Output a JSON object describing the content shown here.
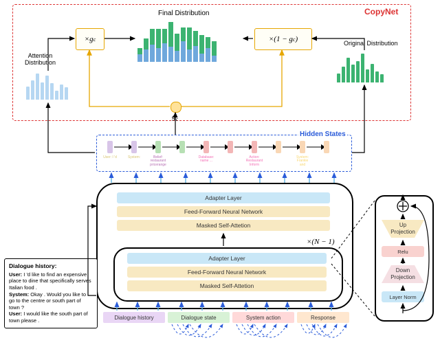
{
  "copynet": {
    "title": "CopyNet",
    "mult_left": "×g",
    "mult_left_sub": "c",
    "mult_right": "×(1 − g",
    "mult_right_sub": "c",
    "mult_right_tail": ")",
    "gc_label": "g",
    "gc_sub": "c",
    "final_label": "Final Distribution",
    "attention_label": "Attention\nDistribution",
    "original_label": "Original Distribution"
  },
  "hidden": {
    "title": "Hidden States",
    "tokens": [
      {
        "label": "User: I 'd",
        "color": "#d8c5e8"
      },
      {
        "label": "System:",
        "color": "#d8c5e8"
      },
      {
        "label": "Belief: restaurant pricerange",
        "color": "#b7e0b4"
      },
      {
        "label": "",
        "color": "#b7e0b4"
      },
      {
        "label": "Database: name ...",
        "color": "#f3b6b6"
      },
      {
        "label": "",
        "color": "#f3b6b6"
      },
      {
        "label": "Action: Restaurant Inform",
        "color": "#f3b6b6"
      },
      {
        "label": "",
        "color": "#f9d7b5"
      },
      {
        "label": "System: Frankie and",
        "color": "#f9d7b5"
      },
      {
        "label": "",
        "color": "#f9d7b5"
      }
    ]
  },
  "transformer": {
    "outer": {
      "adapter": "Adapter Layer",
      "ffn": "Feed-Forward Neural Network",
      "attn": "Masked Self-Attetion"
    },
    "inner": {
      "adapter": "Adapter Layer",
      "ffn": "Feed-Forward Neural Network",
      "attn": "Masked Self-Attetion"
    },
    "repeat": "×(N − 1)"
  },
  "segments": {
    "history": "Dialogue history",
    "state": "Dialogue state",
    "action": "System action",
    "response": "Response"
  },
  "dialogue": {
    "title": "Dialogue history:",
    "u1_role": "User:",
    "u1": "I 'd like to find an expensive place to dine that specifically serves Italian food .",
    "s1_role": "System:",
    "s1": "Okay . Would you like to go to the centre or south part of town ?",
    "u2_role": "User:",
    "u2": "I would like the south part of town please ."
  },
  "adapter_detail": {
    "layernorm": "Layer Norm",
    "down": "Down\nProjection",
    "relu": "Relu",
    "up": "Up\nProjection"
  },
  "chart_data": {
    "attention": {
      "type": "bar",
      "color": "#b6d7f2",
      "values": [
        30,
        45,
        60,
        40,
        55,
        38,
        20,
        35,
        28
      ]
    },
    "original": {
      "type": "bar",
      "color": "#3cb371",
      "values": [
        20,
        35,
        55,
        40,
        48,
        65,
        30,
        42,
        25,
        18
      ]
    },
    "final": {
      "type": "stacked-bar",
      "series": [
        {
          "name": "attention-weighted",
          "color": "#6fa8dc",
          "values": [
            12,
            20,
            28,
            22,
            30,
            25,
            18,
            34,
            20,
            26,
            14,
            22,
            10
          ]
        },
        {
          "name": "original-weighted",
          "color": "#3cb371",
          "values": [
            10,
            18,
            26,
            32,
            24,
            40,
            28,
            22,
            36,
            24,
            30,
            18,
            24
          ]
        }
      ]
    }
  }
}
